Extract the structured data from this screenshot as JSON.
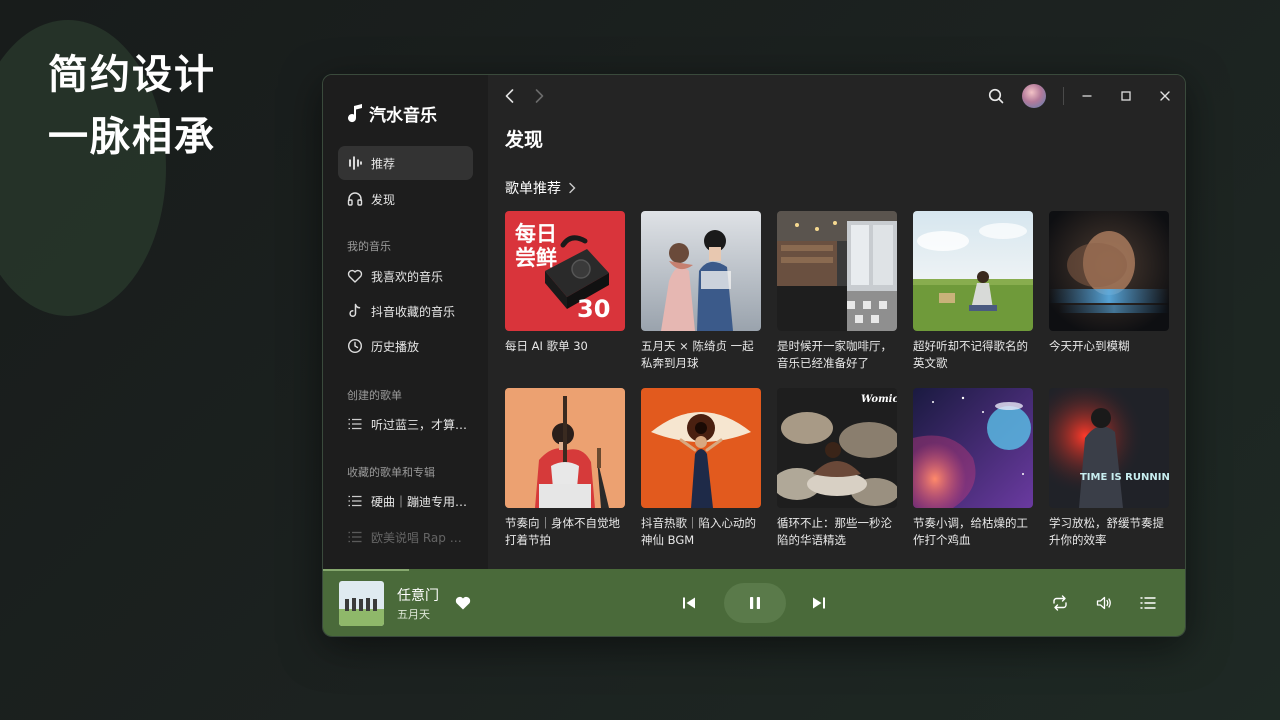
{
  "promo": {
    "line1": "简约设计",
    "line2": "一脉相承"
  },
  "app": {
    "name": "汽水音乐"
  },
  "sidebar": {
    "main_items": [
      {
        "label": "推荐",
        "icon": "waveform-icon",
        "active": true
      },
      {
        "label": "发现",
        "icon": "headphones-icon",
        "active": false
      }
    ],
    "my_music_title": "我的音乐",
    "my_music_items": [
      {
        "label": "我喜欢的音乐",
        "icon": "heart-outline-icon"
      },
      {
        "label": "抖音收藏的音乐",
        "icon": "douyin-icon"
      },
      {
        "label": "历史播放",
        "icon": "clock-icon"
      }
    ],
    "created_title": "创建的歌单",
    "created_items": [
      {
        "label": "听过蓝三，才算…",
        "icon": "list-icon"
      }
    ],
    "collected_title": "收藏的歌单和专辑",
    "collected_items": [
      {
        "label": "硬曲｜蹦迪专用…",
        "icon": "list-icon"
      },
      {
        "label": "欧美说唱 Rap 高…",
        "icon": "list-icon"
      }
    ]
  },
  "main": {
    "page_title": "发现",
    "section_title": "歌单推荐",
    "cards": [
      {
        "caption": "每日 AI 歌单 30",
        "cover": "daily"
      },
      {
        "caption": "五月天 × 陈绮贞 一起私奔到月球",
        "cover": "concert"
      },
      {
        "caption": "是时候开一家咖啡厅，音乐已经准备好了",
        "cover": "cafe"
      },
      {
        "caption": "超好听却不记得歌名的英文歌",
        "cover": "field"
      },
      {
        "caption": "今天开心到模糊",
        "cover": "blur"
      },
      {
        "caption": "节奏向｜身体不自觉地打着节拍",
        "cover": "guitar"
      },
      {
        "caption": "抖音热歌｜陷入心动的神仙 BGM",
        "cover": "eye"
      },
      {
        "caption": "循环不止：那些一秒沦陷的华语精选",
        "cover": "rocks"
      },
      {
        "caption": "节奏小调，给枯燥的工作打个鸡血",
        "cover": "space"
      },
      {
        "caption": "学习放松，舒缓节奏提升你的效率",
        "cover": "running"
      }
    ],
    "daily_cover_text": {
      "line1": "每日",
      "line2": "尝鲜",
      "number": "30"
    },
    "running_cover_text": "TIME IS RUNNING",
    "woman_cover_text": "Womice"
  },
  "player": {
    "song_title": "任意门",
    "artist": "五月天",
    "progress": 0.1,
    "liked": true
  },
  "colors": {
    "accent_green": "#4a6a3a",
    "sidebar_bg": "#1d1d1d",
    "main_bg": "#242424"
  }
}
